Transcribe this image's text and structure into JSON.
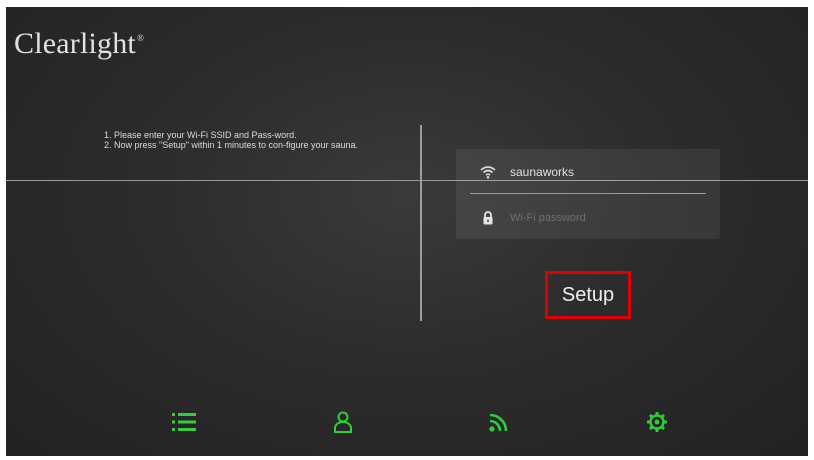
{
  "brand": {
    "name": "Clearlight",
    "mark": "®"
  },
  "instructions": {
    "line1": "1.  Please enter your Wi-Fi SSID and Pass-word.",
    "line2": "2.  Now press \"Setup\" within 1 minutes to con-figure your sauna."
  },
  "wifi_form": {
    "ssid_value": "saunaworks",
    "password_placeholder": "Wi-Fi password",
    "ssid_icon": "wifi-icon",
    "password_icon": "lock-icon"
  },
  "setup_button": {
    "label": "Setup",
    "highlight_color": "#e00000"
  },
  "bottom_nav": {
    "items": [
      {
        "icon": "list-icon"
      },
      {
        "icon": "user-icon"
      },
      {
        "icon": "wifi-signal-icon"
      },
      {
        "icon": "settings-gear-icon"
      }
    ],
    "accent_color": "#2fce3a"
  }
}
